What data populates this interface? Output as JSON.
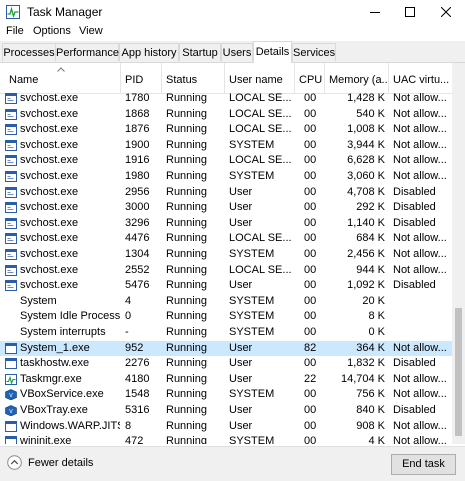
{
  "window": {
    "title": "Task Manager",
    "controls": [
      "minimize-icon",
      "maximize-icon",
      "close-icon"
    ]
  },
  "menu": [
    "File",
    "Options",
    "View"
  ],
  "tabs": [
    {
      "label": "Processes",
      "active": false
    },
    {
      "label": "Performance",
      "active": false
    },
    {
      "label": "App history",
      "active": false
    },
    {
      "label": "Startup",
      "active": false
    },
    {
      "label": "Users",
      "active": false
    },
    {
      "label": "Details",
      "active": true
    },
    {
      "label": "Services",
      "active": false
    }
  ],
  "columns": {
    "name": "Name",
    "pid": "PID",
    "status": "Status",
    "user": "User name",
    "cpu": "CPU",
    "memory": "Memory (a...",
    "uac": "UAC virtu..."
  },
  "rows": [
    {
      "name": "svchost.exe",
      "pid": "1780",
      "status": "Running",
      "user": "LOCAL SE...",
      "cpu": "00",
      "memory": "1,428 K",
      "uac": "Not allow...",
      "icon": "service-host-icon"
    },
    {
      "name": "svchost.exe",
      "pid": "1868",
      "status": "Running",
      "user": "LOCAL SE...",
      "cpu": "00",
      "memory": "540 K",
      "uac": "Not allow...",
      "icon": "service-host-icon"
    },
    {
      "name": "svchost.exe",
      "pid": "1876",
      "status": "Running",
      "user": "LOCAL SE...",
      "cpu": "00",
      "memory": "1,008 K",
      "uac": "Not allow...",
      "icon": "service-host-icon"
    },
    {
      "name": "svchost.exe",
      "pid": "1900",
      "status": "Running",
      "user": "SYSTEM",
      "cpu": "00",
      "memory": "3,944 K",
      "uac": "Not allow...",
      "icon": "service-host-icon"
    },
    {
      "name": "svchost.exe",
      "pid": "1916",
      "status": "Running",
      "user": "LOCAL SE...",
      "cpu": "00",
      "memory": "6,628 K",
      "uac": "Not allow...",
      "icon": "service-host-icon"
    },
    {
      "name": "svchost.exe",
      "pid": "1980",
      "status": "Running",
      "user": "SYSTEM",
      "cpu": "00",
      "memory": "3,060 K",
      "uac": "Not allow...",
      "icon": "service-host-icon"
    },
    {
      "name": "svchost.exe",
      "pid": "2956",
      "status": "Running",
      "user": "User",
      "cpu": "00",
      "memory": "4,708 K",
      "uac": "Disabled",
      "icon": "service-host-icon"
    },
    {
      "name": "svchost.exe",
      "pid": "3000",
      "status": "Running",
      "user": "User",
      "cpu": "00",
      "memory": "292 K",
      "uac": "Disabled",
      "icon": "service-host-icon"
    },
    {
      "name": "svchost.exe",
      "pid": "3296",
      "status": "Running",
      "user": "User",
      "cpu": "00",
      "memory": "1,140 K",
      "uac": "Disabled",
      "icon": "service-host-icon"
    },
    {
      "name": "svchost.exe",
      "pid": "4476",
      "status": "Running",
      "user": "LOCAL SE...",
      "cpu": "00",
      "memory": "684 K",
      "uac": "Not allow...",
      "icon": "service-host-icon"
    },
    {
      "name": "svchost.exe",
      "pid": "1304",
      "status": "Running",
      "user": "SYSTEM",
      "cpu": "00",
      "memory": "2,456 K",
      "uac": "Not allow...",
      "icon": "service-host-icon"
    },
    {
      "name": "svchost.exe",
      "pid": "2552",
      "status": "Running",
      "user": "LOCAL SE...",
      "cpu": "00",
      "memory": "944 K",
      "uac": "Not allow...",
      "icon": "service-host-icon"
    },
    {
      "name": "svchost.exe",
      "pid": "5476",
      "status": "Running",
      "user": "User",
      "cpu": "00",
      "memory": "1,092 K",
      "uac": "Disabled",
      "icon": "service-host-icon"
    },
    {
      "name": "System",
      "pid": "4",
      "status": "Running",
      "user": "SYSTEM",
      "cpu": "00",
      "memory": "20 K",
      "uac": "",
      "icon": "blank-process-icon"
    },
    {
      "name": "System Idle Process",
      "pid": "0",
      "status": "Running",
      "user": "SYSTEM",
      "cpu": "00",
      "memory": "8 K",
      "uac": "",
      "icon": "blank-process-icon"
    },
    {
      "name": "System interrupts",
      "pid": "-",
      "status": "Running",
      "user": "SYSTEM",
      "cpu": "00",
      "memory": "0 K",
      "uac": "",
      "icon": "blank-process-icon"
    },
    {
      "name": "System_1.exe",
      "pid": "952",
      "status": "Running",
      "user": "User",
      "cpu": "82",
      "memory": "364 K",
      "uac": "Not allow...",
      "icon": "application-window-icon",
      "selected": true
    },
    {
      "name": "taskhostw.exe",
      "pid": "2276",
      "status": "Running",
      "user": "User",
      "cpu": "00",
      "memory": "1,832 K",
      "uac": "Disabled",
      "icon": "application-window-icon"
    },
    {
      "name": "Taskmgr.exe",
      "pid": "4180",
      "status": "Running",
      "user": "User",
      "cpu": "22",
      "memory": "14,704 K",
      "uac": "Not allow...",
      "icon": "task-manager-icon"
    },
    {
      "name": "VBoxService.exe",
      "pid": "1548",
      "status": "Running",
      "user": "SYSTEM",
      "cpu": "00",
      "memory": "756 K",
      "uac": "Not allow...",
      "icon": "virtualbox-icon"
    },
    {
      "name": "VBoxTray.exe",
      "pid": "5316",
      "status": "Running",
      "user": "User",
      "cpu": "00",
      "memory": "840 K",
      "uac": "Disabled",
      "icon": "virtualbox-icon"
    },
    {
      "name": "Windows.WARP.JITS...",
      "pid": "8",
      "status": "Running",
      "user": "User",
      "cpu": "00",
      "memory": "908 K",
      "uac": "Not allow...",
      "icon": "application-window-icon"
    },
    {
      "name": "wininit.exe",
      "pid": "472",
      "status": "Running",
      "user": "SYSTEM",
      "cpu": "00",
      "memory": "4 K",
      "uac": "Not allow...",
      "icon": "application-window-icon"
    }
  ],
  "footer": {
    "fewer_details": "Fewer details",
    "end_task": "End task"
  },
  "colors": {
    "selected_row": "#cce8ff",
    "icon_blue": "#2b5ea8"
  }
}
